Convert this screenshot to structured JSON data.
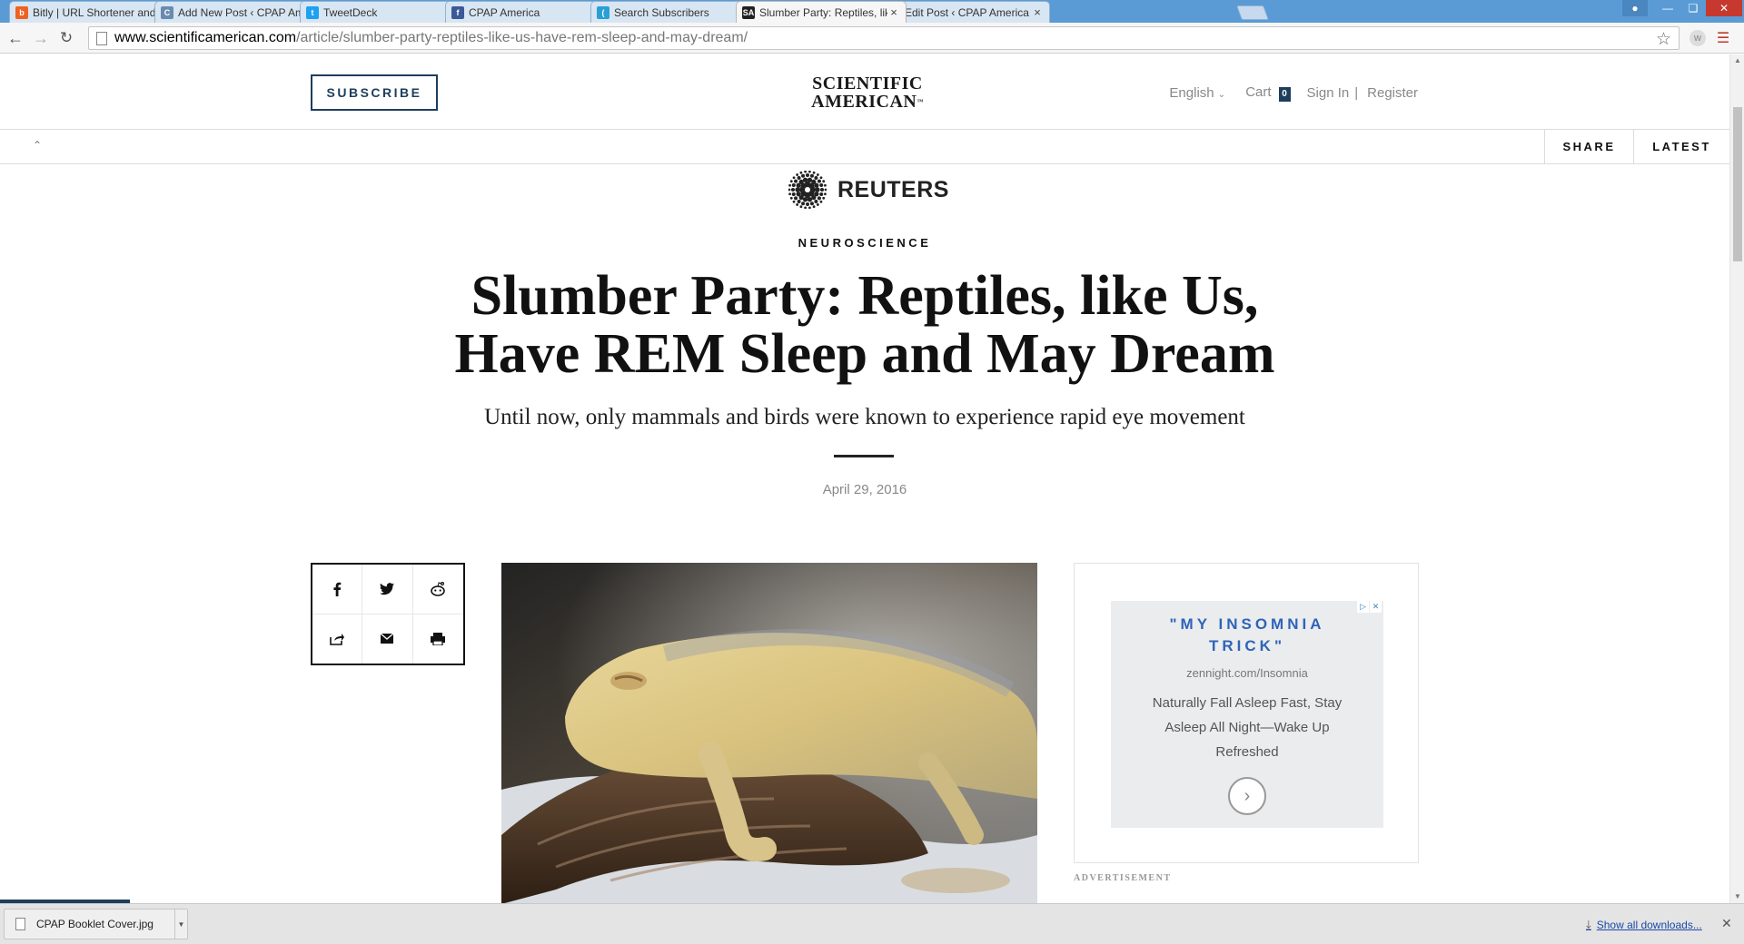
{
  "browser": {
    "tabs": [
      {
        "title": "Bitly | URL Shortener and Link Management",
        "favicon": "bitly-icon",
        "color": "#ee6123",
        "glyph": "b"
      },
      {
        "title": "Add New Post ‹ CPAP America — WordPress",
        "favicon": "cpap-icon",
        "color": "#6a8bb0",
        "glyph": "C"
      },
      {
        "title": "TweetDeck",
        "favicon": "twitter-icon",
        "color": "#1da1f2",
        "glyph": "t"
      },
      {
        "title": "CPAP America",
        "favicon": "facebook-icon",
        "color": "#3b5998",
        "glyph": "f"
      },
      {
        "title": "Search Subscribers",
        "favicon": "subscribers-icon",
        "color": "#2a9fd6",
        "glyph": "("
      },
      {
        "title": "Slumber Party: Reptiles, like Us, Have REM Sleep",
        "favicon": "sa-icon",
        "color": "#222222",
        "glyph": "SA"
      },
      {
        "title": "Edit Post ‹ CPAP America — WordPress",
        "favicon": "cpap-icon",
        "color": "#6a8bb0",
        "glyph": "C"
      }
    ],
    "active_tab": 5,
    "url_host": "www.scientificamerican.com",
    "url_path": "/article/slumber-party-reptiles-like-us-have-rem-sleep-and-may-dream/"
  },
  "header": {
    "subscribe_label": "SUBSCRIBE",
    "logo_line1": "SCIENTIFIC",
    "logo_line2": "AMERICAN",
    "logo_tm": "™",
    "language": "English",
    "cart_label": "Cart",
    "cart_count": "0",
    "sign_in": "Sign In",
    "separator": "|",
    "register": "Register"
  },
  "subbar": {
    "share_label": "SHARE",
    "latest_label": "LATEST"
  },
  "article": {
    "source": "REUTERS",
    "section": "NEUROSCIENCE",
    "headline_line1": "Slumber Party: Reptiles, like Us,",
    "headline_line2": "Have REM Sleep and May Dream",
    "dek": "Until now, only mammals and birds were known to experience rapid eye movement",
    "date": "April 29, 2016"
  },
  "share_icons": [
    "facebook-icon",
    "twitter-icon",
    "reddit-icon",
    "share-icon",
    "email-icon",
    "print-icon"
  ],
  "ad": {
    "headline": "\"MY INSOMNIA TRICK\"",
    "url": "zennight.com/Insomnia",
    "body": "Naturally Fall Asleep Fast, Stay Asleep All Night—Wake Up Refreshed",
    "label": "ADVERTISEMENT"
  },
  "downloads": {
    "file_name": "CPAP Booklet Cover.jpg",
    "show_all": "Show all downloads..."
  },
  "colors": {
    "brand_navy": "#1d3e5c",
    "tabstrip": "#5a9bd5",
    "ad_headline": "#2e64b8"
  }
}
